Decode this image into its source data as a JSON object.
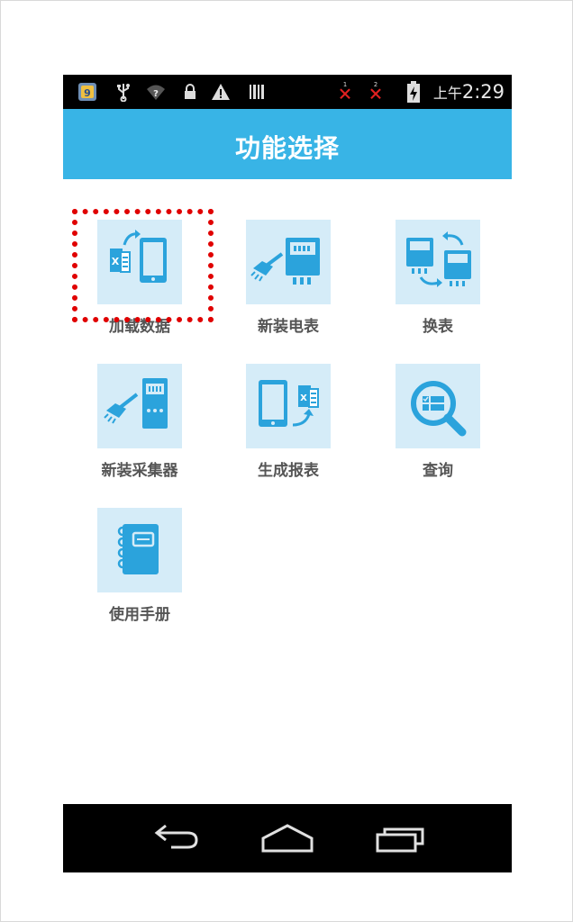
{
  "status_bar": {
    "time_prefix": "上午",
    "time": "2:29",
    "sim1_label": "1",
    "sim2_label": "2",
    "icons": [
      "app-notification-icon",
      "usb-icon",
      "wifi-question-icon",
      "lock-icon",
      "warning-icon",
      "barcode-icon",
      "sim1-no-signal-icon",
      "sim2-no-signal-icon",
      "battery-charging-icon"
    ]
  },
  "header": {
    "title": "功能选择"
  },
  "menu": {
    "items": [
      {
        "label": "加载数据",
        "icon": "load-data-icon"
      },
      {
        "label": "新装电表",
        "icon": "install-meter-icon"
      },
      {
        "label": "换表",
        "icon": "swap-meter-icon"
      },
      {
        "label": "新装采集器",
        "icon": "install-collector-icon"
      },
      {
        "label": "生成报表",
        "icon": "generate-report-icon"
      },
      {
        "label": "查询",
        "icon": "search-icon"
      },
      {
        "label": "使用手册",
        "icon": "manual-icon"
      }
    ],
    "highlighted_index": 0,
    "highlight_color": "#e00000"
  },
  "nav_bar": {
    "icons": [
      "back-icon",
      "home-icon",
      "recent-apps-icon"
    ]
  },
  "colors": {
    "accent": "#38b4e6",
    "icon_blue": "#2ba3dc",
    "icon_bg": "#d5ecf8",
    "label": "#555555"
  }
}
